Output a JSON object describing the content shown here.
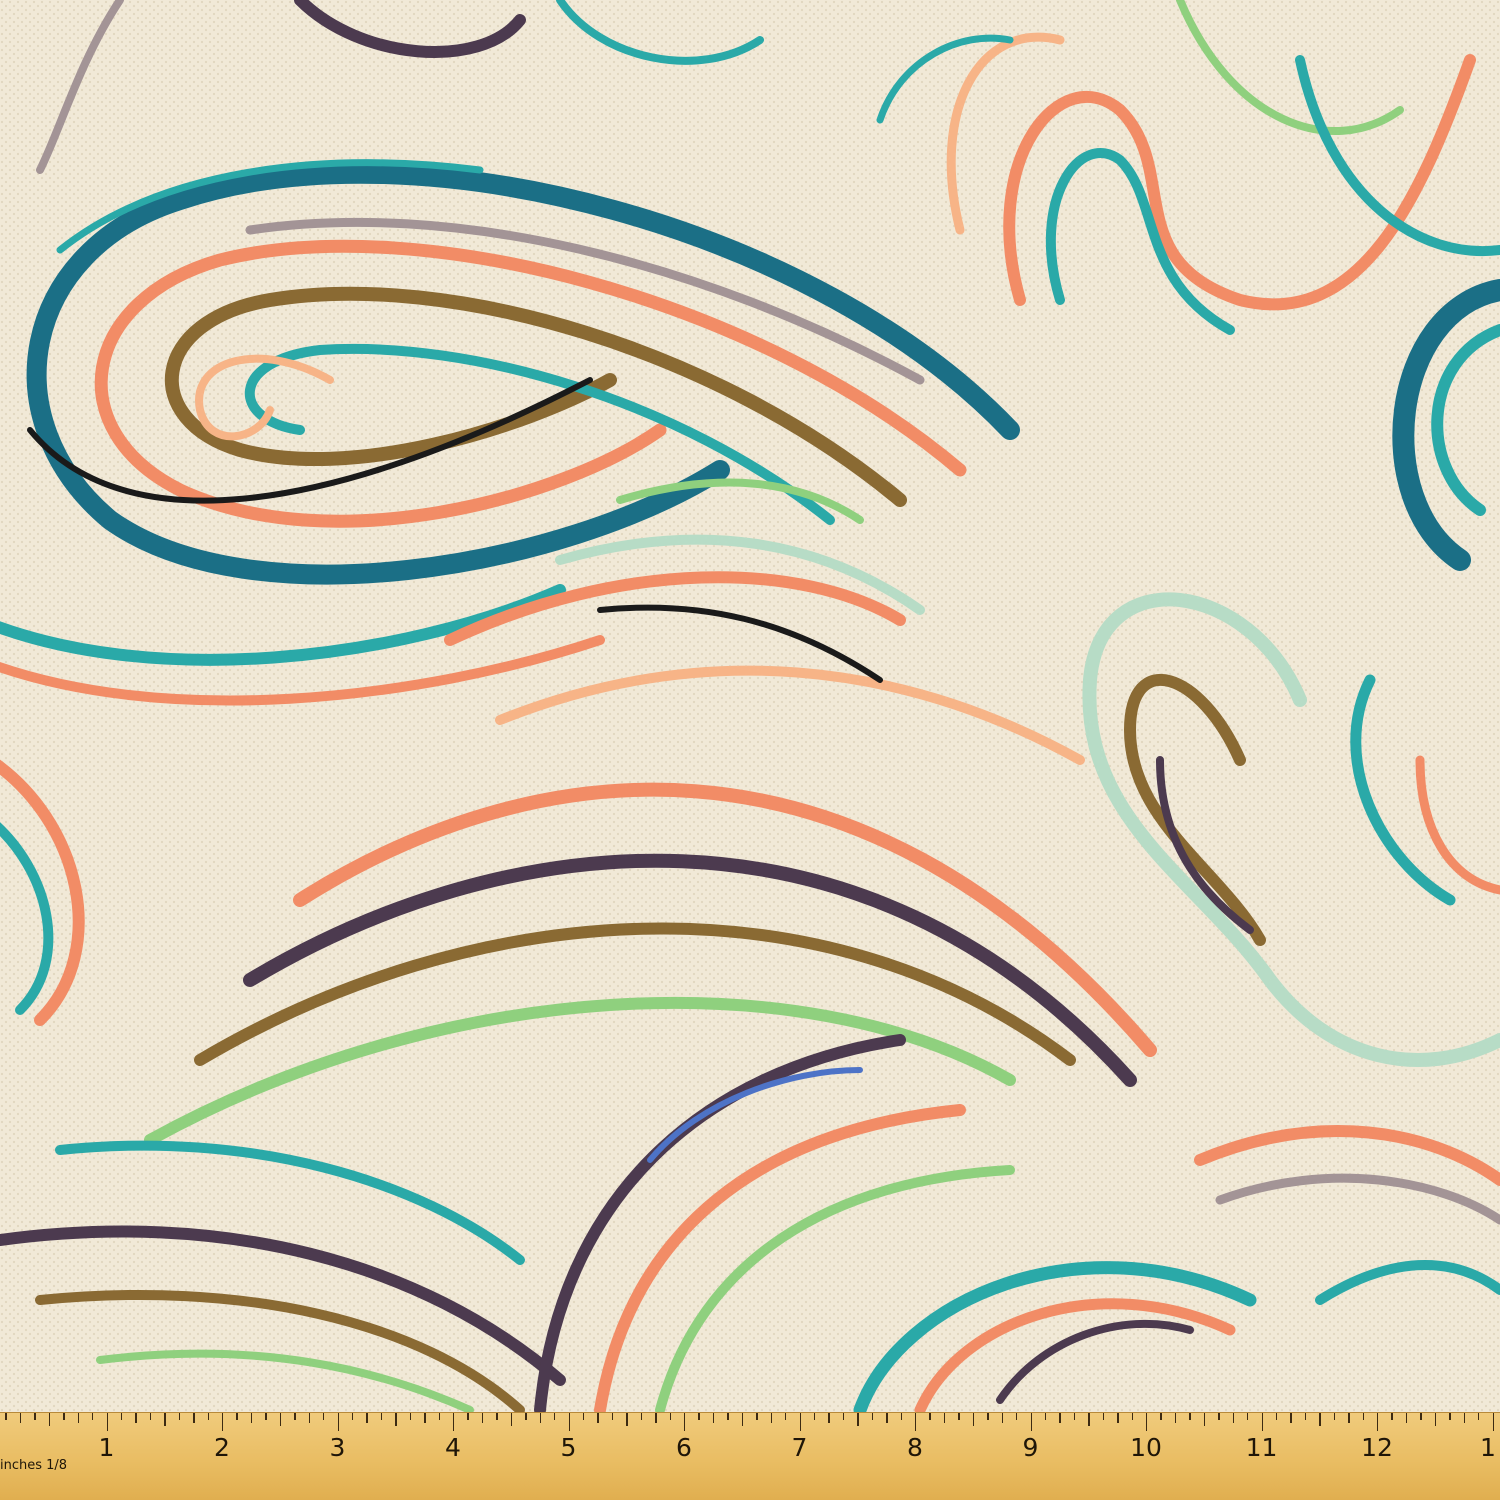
{
  "colors": {
    "background": "#f1e9d7",
    "teal": "#2aa9a8",
    "teal_dark": "#1b6f86",
    "coral": "#f28c66",
    "peach": "#f7b487",
    "green": "#8fd07e",
    "mint": "#b7dcc6",
    "brown": "#8a6a33",
    "plum": "#4c3a4f",
    "gray": "#a39496",
    "black": "#1a1a1a",
    "blue": "#4d73c7",
    "ruler": "#ecc26c"
  },
  "ruler": {
    "caption": "inches 1/8",
    "numbers": [
      "1",
      "2",
      "3",
      "4",
      "5",
      "6",
      "7",
      "8",
      "9",
      "10",
      "11",
      "12",
      "1"
    ]
  }
}
